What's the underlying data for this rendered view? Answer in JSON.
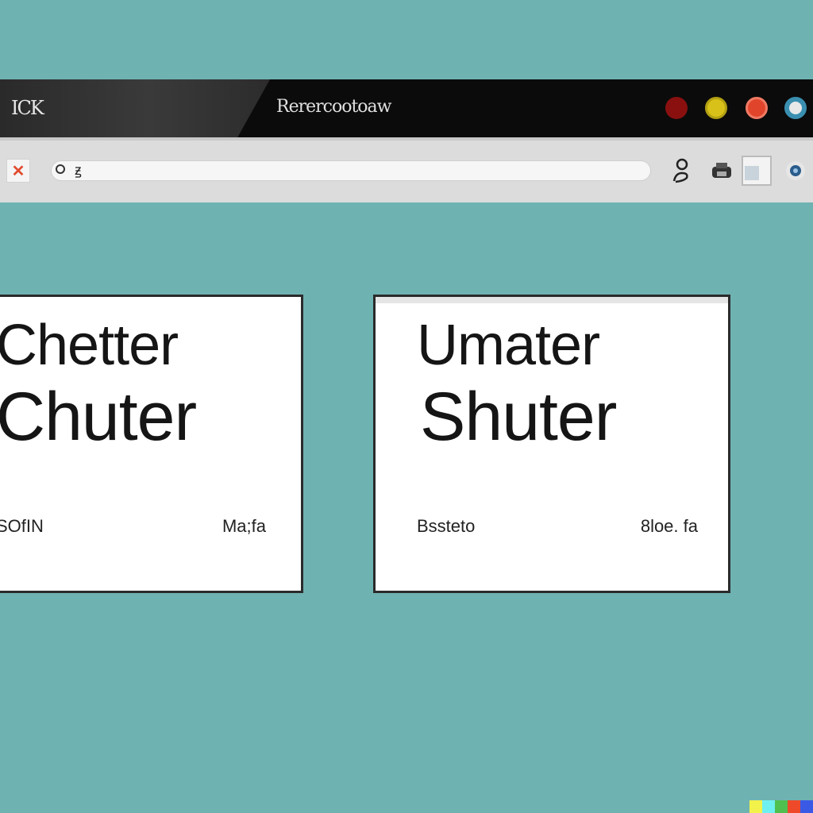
{
  "window": {
    "logo_text": "ICK",
    "title": "Rerercootoaw"
  },
  "titlebar": {
    "buttons": [
      {
        "name": "dark-red-circle-icon",
        "color": "#8a1010"
      },
      {
        "name": "yellow-circle-icon",
        "color": "#d8c21a"
      },
      {
        "name": "red-circle-icon",
        "color": "#e0452c"
      },
      {
        "name": "blue-circle-icon",
        "color": "#5aa8c8"
      }
    ]
  },
  "toolbar": {
    "favicon": "✕",
    "address_text": "ꙃ",
    "icons": [
      "person-icon",
      "printer-icon",
      "window-icon",
      "globe-icon"
    ]
  },
  "cards": [
    {
      "line1": "Chetter",
      "line2": "Chuter",
      "footer_left": "SOfIN",
      "footer_right": "Ma;fa"
    },
    {
      "line1": "Umater",
      "line2": "Shuter",
      "footer_left": "Bssteto",
      "footer_right": "8loe. fa"
    }
  ],
  "colors": {
    "background": "#6fb2b2",
    "titlebar": "#0b0b0b",
    "toolbar": "#dcdcdc"
  }
}
